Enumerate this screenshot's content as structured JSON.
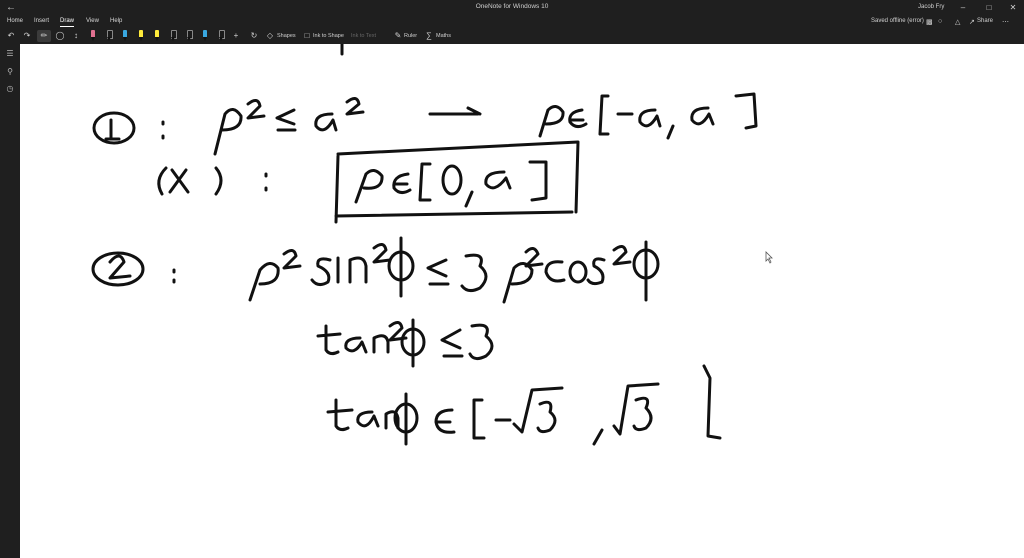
{
  "app": {
    "title": "OneNote for Windows 10",
    "user": "Jacob Fry"
  },
  "menu": {
    "tabs": [
      {
        "label": "Home"
      },
      {
        "label": "Insert"
      },
      {
        "label": "Draw"
      },
      {
        "label": "View"
      },
      {
        "label": "Help"
      }
    ],
    "active_tab": "Draw",
    "status": "Saved offline (error)",
    "share_label": "Share"
  },
  "toolbar": {
    "shapes_label": "Shapes",
    "ink_to_shape_label": "Ink to Shape",
    "ink_to_text_label": "Ink to Text",
    "ruler_label": "Ruler",
    "maths_label": "Maths",
    "pen_colors": [
      "#e07090",
      "#1a1a1a",
      "#39a7e0",
      "#ffeb3b",
      "#ffeb3b",
      "#1a1a1a",
      "#1a1a1a",
      "#39a7e0",
      "#1a1a1a"
    ]
  },
  "sidebar": {
    "icons": [
      "notebooks-icon",
      "search-icon",
      "recent-icon"
    ]
  }
}
